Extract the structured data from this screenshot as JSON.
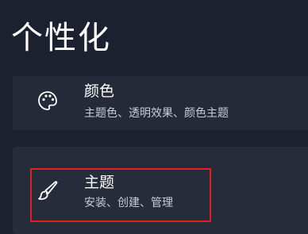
{
  "page": {
    "title": "个性化"
  },
  "settings_items": [
    {
      "title": "颜色",
      "description": "主题色、透明效果、颜色主题",
      "icon": "palette-icon"
    },
    {
      "title": "主题",
      "description": "安装、创建、管理",
      "icon": "brush-icon"
    }
  ],
  "colors": {
    "background": "#1c2130",
    "card": "#272c3b",
    "highlight": "#e0201f"
  }
}
